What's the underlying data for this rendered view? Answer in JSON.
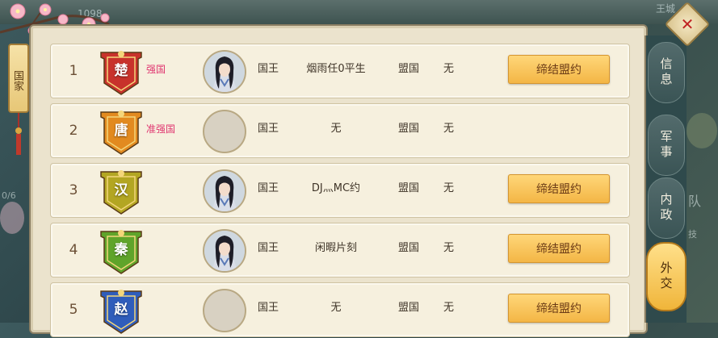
{
  "background": {
    "top_right_label": "王城",
    "top_left_number": "1098",
    "side_fragments": [
      "0/6",
      "队",
      "技"
    ]
  },
  "left_tab": {
    "label": "国家"
  },
  "side_tabs": [
    {
      "label": "信息",
      "active": false
    },
    {
      "label": "军事",
      "active": false
    },
    {
      "label": "内政",
      "active": false
    },
    {
      "label": "外交",
      "active": true
    }
  ],
  "close": {
    "symbol": "✕"
  },
  "columns": {
    "king_label": "国王",
    "ally_label": "盟国"
  },
  "rows": [
    {
      "rank": "1",
      "country": "楚",
      "banner_color": "#c8322b",
      "status": "强国",
      "has_avatar": true,
      "player": "烟雨任0平生",
      "ally": "无",
      "button": "缔结盟约"
    },
    {
      "rank": "2",
      "country": "唐",
      "banner_color": "#e28a1f",
      "status": "准强国",
      "has_avatar": false,
      "player": "无",
      "ally": "无",
      "button": ""
    },
    {
      "rank": "3",
      "country": "汉",
      "banner_color": "#b3a622",
      "status": "",
      "has_avatar": true,
      "player": "DJ灬MC约",
      "ally": "无",
      "button": "缔结盟约"
    },
    {
      "rank": "4",
      "country": "秦",
      "banner_color": "#5fa42a",
      "status": "",
      "has_avatar": true,
      "player": "闲暇片刻",
      "ally": "无",
      "button": "缔结盟约"
    },
    {
      "rank": "5",
      "country": "赵",
      "banner_color": "#2f5dbb",
      "status": "",
      "has_avatar": false,
      "player": "无",
      "ally": "无",
      "button": "缔结盟约"
    }
  ]
}
